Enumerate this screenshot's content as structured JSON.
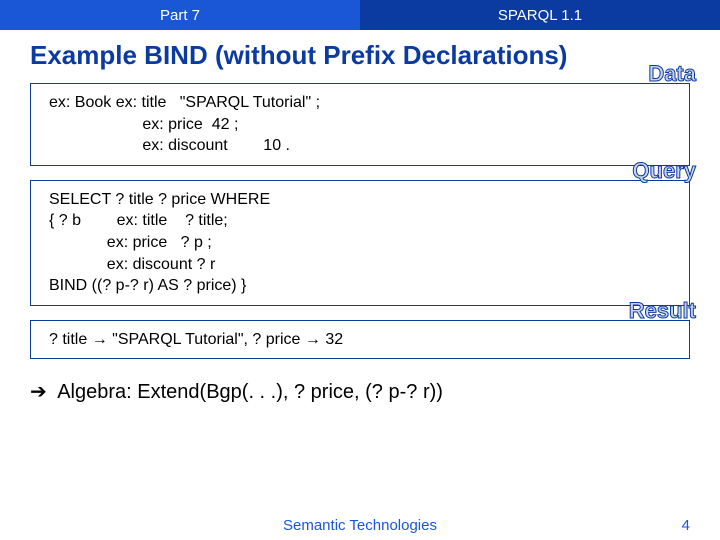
{
  "header": {
    "left": "Part 7",
    "right": "SPARQL 1.1"
  },
  "title": {
    "prefix": "Example ",
    "keyword": "BIND",
    "suffix": " (without Prefix Declarations)"
  },
  "data_box": {
    "label": "Data",
    "content": "ex: Book ex: title   \"SPARQL Tutorial\" ;\n                     ex: price  42 ;\n                     ex: discount        10 ."
  },
  "query_box": {
    "label": "Query",
    "content": "SELECT ? title ? price WHERE\n{ ? b        ex: title    ? title;\n             ex: price   ? p ;\n             ex: discount ? r\nBIND ((? p-? r) AS ? price) }"
  },
  "result_box": {
    "label": "Result",
    "content": "? title → \"SPARQL Tutorial\", ? price → 32"
  },
  "algebra": {
    "arrow": "➔",
    "text": " Algebra:  Extend(Bgp(. . .), ? price, (? p-? r))"
  },
  "footer": {
    "text": "Semantic Technologies",
    "page": "4"
  }
}
